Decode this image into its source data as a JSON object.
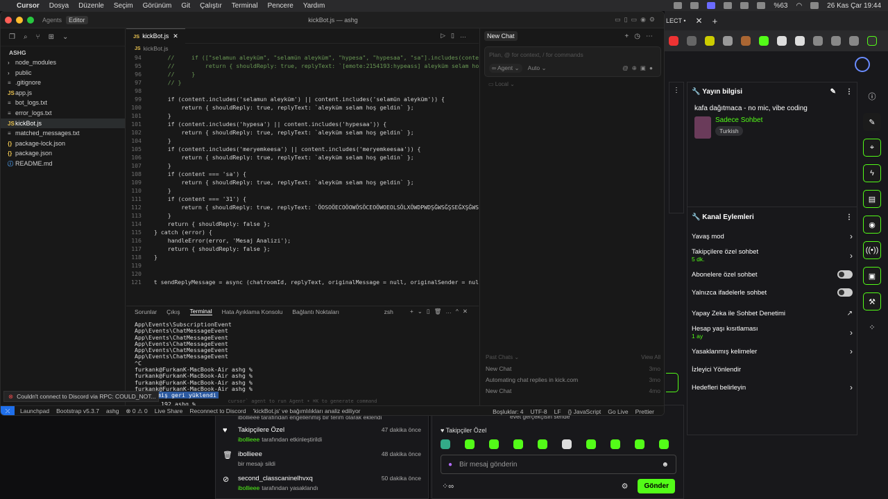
{
  "menubar": {
    "app": "Cursor",
    "items": [
      "Dosya",
      "Düzenle",
      "Seçim",
      "Görünüm",
      "Git",
      "Çalıştır",
      "Terminal",
      "Pencere",
      "Yardım"
    ],
    "battery": "%63",
    "datetime": "26 Kas Çar  19:44"
  },
  "window": {
    "title": "kickBot.js — ashg",
    "tabs_left": [
      "Agents",
      "Editor"
    ]
  },
  "sidebar": {
    "root": "ASHG",
    "items": [
      {
        "icon": "›",
        "label": "node_modules",
        "type": "folder"
      },
      {
        "icon": "›",
        "label": "public",
        "type": "folder"
      },
      {
        "icon": "≡",
        "label": ".gitignore",
        "type": "file"
      },
      {
        "icon": "JS",
        "label": "app.js",
        "type": "js"
      },
      {
        "icon": "≡",
        "label": "bot_logs.txt",
        "type": "file"
      },
      {
        "icon": "≡",
        "label": "error_logs.txt",
        "type": "file"
      },
      {
        "icon": "JS",
        "label": "kickBot.js",
        "type": "js",
        "selected": true
      },
      {
        "icon": "≡",
        "label": "matched_messages.txt",
        "type": "file"
      },
      {
        "icon": "{}",
        "label": "package-lock.json",
        "type": "json"
      },
      {
        "icon": "{}",
        "label": "package.json",
        "type": "json"
      },
      {
        "icon": "ⓘ",
        "label": "README.md",
        "type": "md"
      }
    ]
  },
  "editor": {
    "tab": "kickBot.js",
    "breadcrumb": "kickBot.js",
    "lines": [
      {
        "n": "94",
        "t": "    //     if ([\"selamun aleyküm\", \"selamün aleyküm\", \"hypesa\", \"hypesaa\", \"sa\"].includes(conten"
      },
      {
        "n": "95",
        "t": "    //         return { shouldReply: true, replyText: `[emote:2154193:hypeass] aleyküm selam ho"
      },
      {
        "n": "96",
        "t": "    //     }"
      },
      {
        "n": "97",
        "t": "    // }"
      },
      {
        "n": "98",
        "t": ""
      },
      {
        "n": "99",
        "t": "    if (content.includes('selamun aleyküm') || content.includes('selamün aleyküm')) {"
      },
      {
        "n": "100",
        "t": "        return { shouldReply: true, replyText: `aleyküm selam hoş geldin` };"
      },
      {
        "n": "101",
        "t": "    }"
      },
      {
        "n": "101",
        "t": "    if (content.includes('hypesa') || content.includes('hypesaa')) {"
      },
      {
        "n": "102",
        "t": "        return { shouldReply: true, replyText: `aleyküm selam hoş geldin` };"
      },
      {
        "n": "104",
        "t": "    }"
      },
      {
        "n": "105",
        "t": "    if (content.includes('meryemkeesa') || content.includes('meryemkeesaa')) {"
      },
      {
        "n": "106",
        "t": "        return { shouldReply: true, replyText: `aleyküm selam hoş geldin` };"
      },
      {
        "n": "107",
        "t": "    }"
      },
      {
        "n": "108",
        "t": "    if (content === 'sa') {"
      },
      {
        "n": "109",
        "t": "        return { shouldReply: true, replyText: `aleyküm selam hoş geldin` };"
      },
      {
        "n": "110",
        "t": "    }"
      },
      {
        "n": "111",
        "t": "    if (content === '31') {"
      },
      {
        "n": "112",
        "t": "        return { shouldReply: true, replyText: `ÖOSOÖECOÖOWÖSÖCEOÖWOEOLSÖLXÖWDPWDŞĞWSĞŞSEĞXŞĞWSŞ"
      },
      {
        "n": "113",
        "t": "    }"
      },
      {
        "n": "114",
        "t": "    return { shouldReply: false };"
      },
      {
        "n": "115",
        "t": "} catch (error) {"
      },
      {
        "n": "116",
        "t": "    handleError(error, 'Mesaj Analizi');"
      },
      {
        "n": "117",
        "t": "    return { shouldReply: false };"
      },
      {
        "n": "118",
        "t": "}"
      },
      {
        "n": "119",
        "t": ""
      },
      {
        "n": "120",
        "t": ""
      },
      {
        "n": "121",
        "t": "t sendReplyMessage = async (chatroomId, replyText, originalMessage = null, originalSender = null"
      }
    ]
  },
  "terminal": {
    "tabs": [
      "Sorunlar",
      "Çıkış",
      "Terminal",
      "Hata Ayıklama Konsolu",
      "Bağlantı Noktaları"
    ],
    "shell": "zsh",
    "lines": [
      "App\\Events\\SubscriptionEvent",
      "App\\Events\\ChatMessageEvent",
      "App\\Events\\ChatMessageEvent",
      "App\\Events\\ChatMessageEvent",
      "App\\Events\\ChatMessageEvent",
      "App\\Events\\ChatMessageEvent",
      "^C",
      "furkank@FurkanK-MacBook-Air ashg %",
      "furkank@FurkanK-MacBook-Air ashg %",
      "furkank@FurkanK-MacBook-Air ashg %",
      "furkank@FurkanK-MacBook-Air ashg %"
    ],
    "restored": "✱  Geçmiş geri yüklendi",
    "last": "192 ashg %",
    "hint": "cursor` agent to run Agent • ⌘K to generate command"
  },
  "chat": {
    "tab": "New Chat",
    "placeholder": "Plan, @ for context, / for commands",
    "agent": "∞ Agent ⌄",
    "auto": "Auto ⌄",
    "local": "▭ Local ⌄",
    "past_label": "Past Chats ⌄",
    "view_all": "View All",
    "past": [
      {
        "t": "New Chat",
        "a": "3mo"
      },
      {
        "t": "Automating chat replies in kick.com",
        "a": "3mo"
      },
      {
        "t": "New Chat",
        "a": "4mo"
      }
    ]
  },
  "notification": {
    "text": "Couldn't connect to Discord via RPC: COULD_NOT..."
  },
  "statusbar": {
    "items": [
      "Launchpad",
      "Bootstrap v5.3.7",
      "ashg",
      "⊗ 0 ⚠ 0",
      "Live Share",
      "Reconnect to Discord",
      "'kickBot.js' ve bağımlılıkları analiz ediliyor"
    ],
    "right": [
      "Boşluklar: 4",
      "UTF-8",
      "LF",
      "{} JavaScript",
      "Go Live",
      "Prettier"
    ]
  },
  "kick": {
    "tabtext": "LECT •",
    "stream_info_title": "Yayın bilgisi",
    "stream_title": "kafa dağıtmaca - no mic, vibe coding",
    "category": "Sadece Sohbet",
    "lang": "Turkish",
    "actions_title": "Kanal Eylemleri",
    "actions": [
      {
        "label": "Yavaş mod",
        "sub": "",
        "ctrl": "chev"
      },
      {
        "label": "Takipçilere özel sohbet",
        "sub": "5 dk.",
        "ctrl": "chev"
      },
      {
        "label": "Abonelere özel sohbet",
        "sub": "",
        "ctrl": "toggle"
      },
      {
        "label": "Yalnızca ifadelerle sohbet",
        "sub": "",
        "ctrl": "toggle"
      },
      {
        "label": "Yapay Zeka ile Sohbet Denetimi",
        "sub": "",
        "ctrl": "ext"
      },
      {
        "label": "Hesap yaşı kısıtlaması",
        "sub": "1 ay",
        "ctrl": "chev"
      },
      {
        "label": "Yasaklanmış kelimeler",
        "sub": "",
        "ctrl": "chev"
      },
      {
        "label": "İzleyici Yönlendir",
        "sub": "",
        "ctrl": ""
      },
      {
        "label": "Hedefleri belirleyin",
        "sub": "",
        "ctrl": "chev"
      }
    ]
  },
  "activity": {
    "top": "ibollieee tarafından engellenmiş bir terim olarak eklendi",
    "items": [
      {
        "icon": "♥",
        "title": "Takipçilere Özel",
        "when": "47 dakika önce",
        "user": "ibollieee",
        "rest": "tarafından etkinleştirildi"
      },
      {
        "icon": "🗑",
        "title": "ibollieee",
        "when": "48 dakika önce",
        "user": "",
        "rest": "bir mesajı sildi"
      },
      {
        "icon": "⊘",
        "title": "second_classcaninelhvxq",
        "when": "50 dakika önce",
        "user": "ibollieee",
        "rest": "tarafından yasaklandı"
      }
    ]
  },
  "chatbox": {
    "top": "evet gerçekçisin sende",
    "followers_only": "♥ Takipçiler Özel",
    "placeholder": "Bir mesaj gönderin",
    "send": "Gönder"
  }
}
